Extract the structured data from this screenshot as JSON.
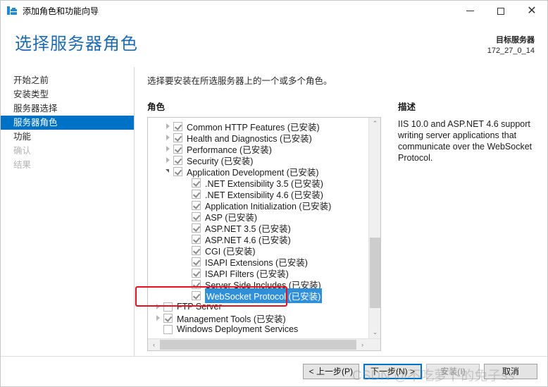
{
  "window": {
    "title": "添加角色和功能向导",
    "icon": "server-manager-icon",
    "minimize": "—",
    "maximize": "▢",
    "close": "✕"
  },
  "header": {
    "page_title": "选择服务器角色",
    "target_label": "目标服务器",
    "target_value": "172_27_0_14"
  },
  "sidebar": {
    "items": [
      {
        "label": "开始之前",
        "state": "normal"
      },
      {
        "label": "安装类型",
        "state": "normal"
      },
      {
        "label": "服务器选择",
        "state": "normal"
      },
      {
        "label": "服务器角色",
        "state": "selected"
      },
      {
        "label": "功能",
        "state": "normal"
      },
      {
        "label": "确认",
        "state": "disabled"
      },
      {
        "label": "结果",
        "state": "disabled"
      }
    ]
  },
  "content": {
    "instruction": "选择要安装在所选服务器上的一个或多个角色。",
    "roles_header": "角色",
    "description_header": "描述",
    "description_text": "IIS 10.0 and ASP.NET 4.6 support writing server applications that communicate over the WebSocket Protocol."
  },
  "tree": {
    "nodes": [
      {
        "label": "Common HTTP Features (已安装)",
        "level": 1,
        "arrow": "collapsed",
        "checked": true,
        "selected": false
      },
      {
        "label": "Health and Diagnostics (已安装)",
        "level": 1,
        "arrow": "collapsed",
        "checked": true,
        "selected": false
      },
      {
        "label": "Performance (已安装)",
        "level": 1,
        "arrow": "collapsed",
        "checked": true,
        "selected": false
      },
      {
        "label": "Security (已安装)",
        "level": 1,
        "arrow": "collapsed",
        "checked": true,
        "selected": false
      },
      {
        "label": "Application Development (已安装)",
        "level": 1,
        "arrow": "expanded",
        "checked": true,
        "selected": false
      },
      {
        "label": ".NET Extensibility 3.5 (已安装)",
        "level": 2,
        "arrow": "none",
        "checked": true,
        "selected": false
      },
      {
        "label": ".NET Extensibility 4.6 (已安装)",
        "level": 2,
        "arrow": "none",
        "checked": true,
        "selected": false
      },
      {
        "label": "Application Initialization (已安装)",
        "level": 2,
        "arrow": "none",
        "checked": true,
        "selected": false
      },
      {
        "label": "ASP (已安装)",
        "level": 2,
        "arrow": "none",
        "checked": true,
        "selected": false
      },
      {
        "label": "ASP.NET 3.5 (已安装)",
        "level": 2,
        "arrow": "none",
        "checked": true,
        "selected": false
      },
      {
        "label": "ASP.NET 4.6 (已安装)",
        "level": 2,
        "arrow": "none",
        "checked": true,
        "selected": false
      },
      {
        "label": "CGI (已安装)",
        "level": 2,
        "arrow": "none",
        "checked": true,
        "selected": false
      },
      {
        "label": "ISAPI Extensions (已安装)",
        "level": 2,
        "arrow": "none",
        "checked": true,
        "selected": false
      },
      {
        "label": "ISAPI Filters (已安装)",
        "level": 2,
        "arrow": "none",
        "checked": true,
        "selected": false
      },
      {
        "label": "Server Side Includes (已安装)",
        "level": 2,
        "arrow": "none",
        "checked": true,
        "selected": false
      },
      {
        "label": "WebSocket Protocol (已安装)",
        "level": 2,
        "arrow": "none",
        "checked": true,
        "selected": true
      },
      {
        "label": "FTP Server",
        "level": 0,
        "arrow": "collapsed",
        "checked": false,
        "selected": false
      },
      {
        "label": "Management Tools (已安装)",
        "level": 0,
        "arrow": "collapsed",
        "checked": true,
        "selected": false
      },
      {
        "label": "Windows Deployment Services",
        "level": 0,
        "arrow": "none",
        "checked": false,
        "selected": false
      }
    ],
    "vscroll_up": "⌃",
    "vscroll_down": "⌄",
    "hscroll_left": "‹",
    "hscroll_right": "›"
  },
  "footer": {
    "previous": "< 上一步(P)",
    "next": "下一步(N) >",
    "install": "安装(I)",
    "cancel": "取消"
  },
  "watermark": {
    "text": "CSDN @不吃萝卜的兔子ss"
  },
  "colors": {
    "accent": "#0072c6",
    "title_blue": "#1f6bb0",
    "selection_blue": "#2f8fd8",
    "annotation_red": "#e81123"
  }
}
